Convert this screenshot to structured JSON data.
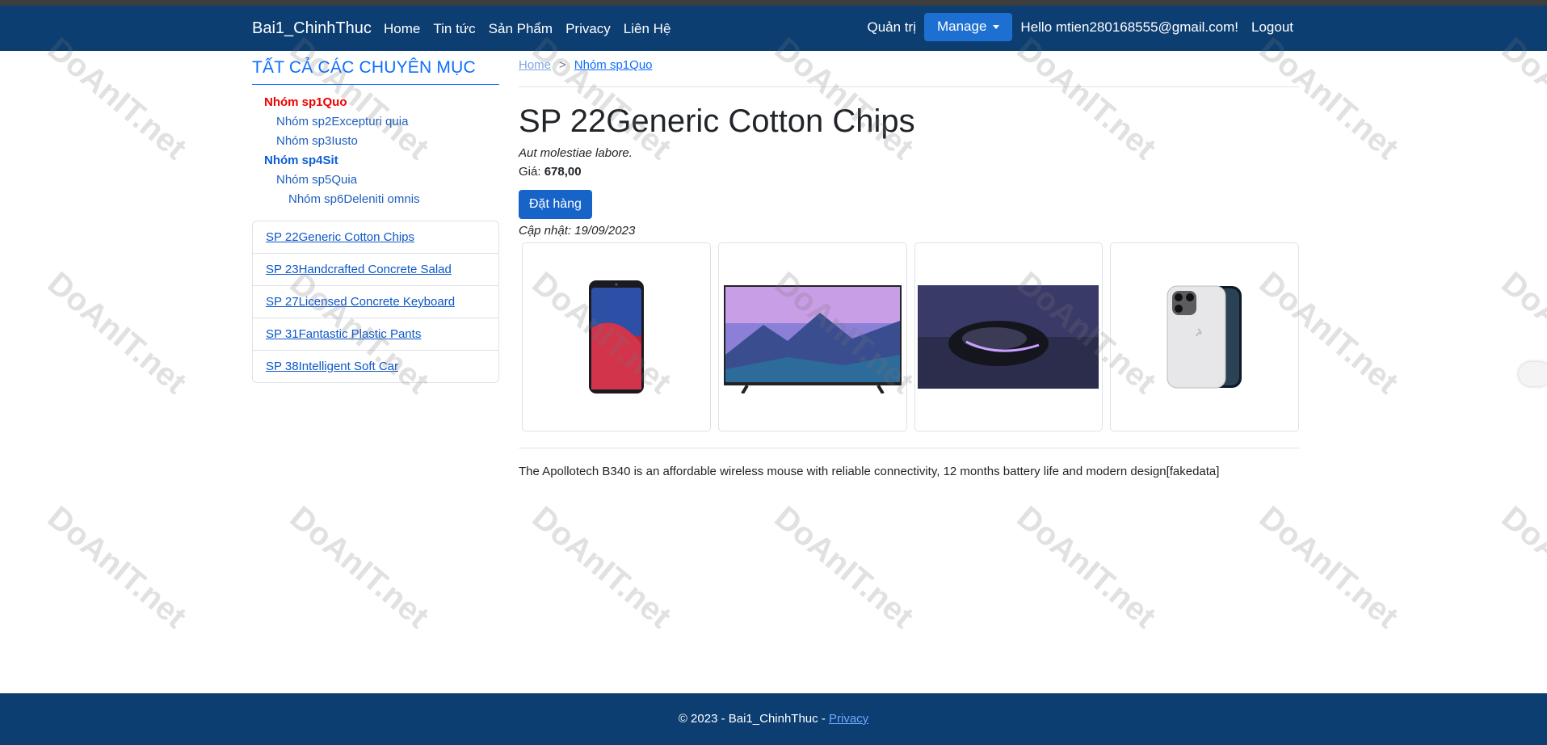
{
  "nav": {
    "brand": "Bai1_ChinhThuc",
    "links": [
      "Home",
      "Tin tức",
      "Sản Phẩm",
      "Privacy",
      "Liên Hệ"
    ],
    "admin_label": "Quản trị",
    "manage_label": "Manage",
    "greeting": "Hello mtien280168555@gmail.com!",
    "logout_label": "Logout"
  },
  "sidebar": {
    "heading": "TẤT CẢ CÁC CHUYÊN MỤC",
    "categories": [
      {
        "label": "Nhóm sp1Quo",
        "level": 1,
        "active": true
      },
      {
        "label": "Nhóm sp2Excepturi quia",
        "level": 2
      },
      {
        "label": "Nhóm sp3Iusto",
        "level": 2
      },
      {
        "label": "Nhóm sp4Sit",
        "level": 1
      },
      {
        "label": "Nhóm sp5Quia",
        "level": 2
      },
      {
        "label": "Nhóm sp6Deleniti omnis",
        "level": 3
      }
    ],
    "products": [
      "SP 22Generic Cotton Chips",
      "SP 23Handcrafted Concrete Salad",
      "SP 27Licensed Concrete Keyboard",
      "SP 31Fantastic Plastic Pants",
      "SP 38Intelligent Soft Car"
    ]
  },
  "breadcrumb": {
    "home": "Home",
    "separator": ">",
    "current": "Nhóm sp1Quo"
  },
  "product": {
    "title": "SP 22Generic Cotton Chips",
    "short_desc": "Aut molestiae labore.",
    "price_label": "Giá:",
    "price_value": "678,00",
    "order_button": "Đặt hàng",
    "updated": "Cập nhật: 19/09/2023",
    "images": [
      "phone-image",
      "tv-image",
      "mouse-image",
      "iphone-image"
    ],
    "description": "The Apollotech B340 is an affordable wireless mouse with reliable connectivity, 12 months battery life and modern design[fakedata]"
  },
  "footer": {
    "text": "© 2023 - Bai1_ChinhThuc - ",
    "privacy": "Privacy"
  },
  "watermark": "DoAnIT.net"
}
